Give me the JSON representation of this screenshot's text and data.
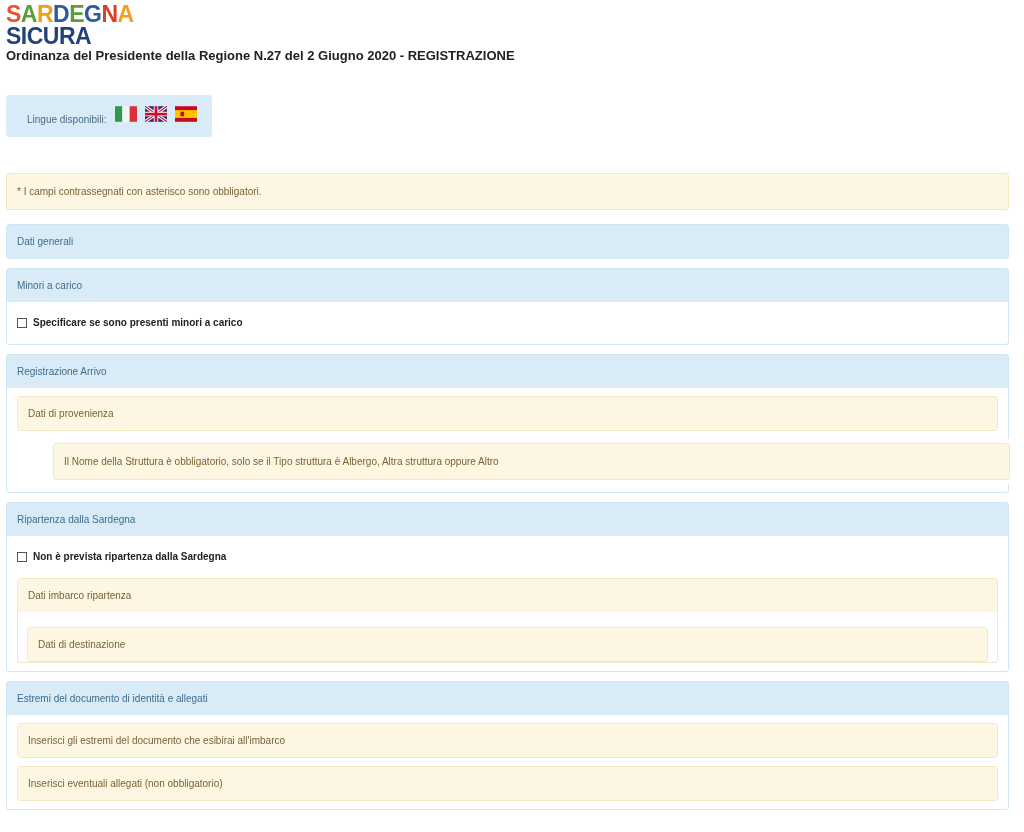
{
  "logo": {
    "line1": "SARDEGNA",
    "line2": "SICURA"
  },
  "title": "Ordinanza del Presidente della Regione N.27 del 2 Giugno 2020 - REGISTRAZIONE",
  "languages": {
    "label": "Lingue disponibili:",
    "flags": [
      {
        "kind": "it"
      },
      {
        "kind": "en"
      },
      {
        "kind": "es"
      }
    ]
  },
  "notice": "* I campi contrassegnati con asterisco sono obbligatori.",
  "panels": [
    {
      "title": "Dati generali"
    },
    {
      "title": "Minori a carico",
      "items": [
        {
          "kind": "checkbox",
          "label": "Specificare se sono presenti minori a carico",
          "checked": false
        }
      ]
    },
    {
      "title": "Registrazione Arrivo",
      "items": [
        {
          "kind": "subpanel",
          "title": "Dati di provenienza"
        },
        {
          "kind": "note",
          "text": "Il Nome della Struttura è obbligatorio, solo se il Tipo struttura è Albergo, Altra struttura oppure Altro"
        }
      ]
    },
    {
      "title": "Ripartenza dalla Sardegna",
      "items": [
        {
          "kind": "checkbox",
          "label": "Non è prevista ripartenza dalla Sardegna",
          "checked": false
        },
        {
          "kind": "subpanel",
          "title": "Dati imbarco ripartenza",
          "children": [
            {
              "kind": "subpanel",
              "title": "Dati di destinazione"
            }
          ]
        }
      ]
    },
    {
      "title": "Estremi del documento di identità e allegati",
      "items": [
        {
          "kind": "subpanel",
          "title": "Inserisci gli estremi del documento che esibirai all'imbarco"
        },
        {
          "kind": "subpanel",
          "title": "Inserisci eventuali allegati (non obbligatorio)"
        }
      ]
    }
  ]
}
